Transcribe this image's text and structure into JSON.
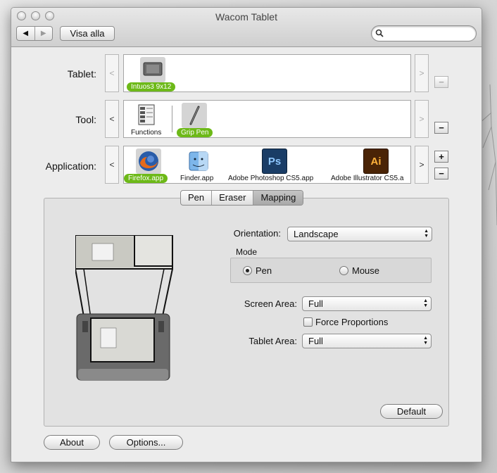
{
  "window": {
    "title": "Wacom Tablet"
  },
  "toolbar": {
    "show_all_label": "Visa alla",
    "search_value": ""
  },
  "rows": {
    "tablet": {
      "label": "Tablet:",
      "items": [
        {
          "name": "Intuos3 9x12",
          "selected": true
        }
      ]
    },
    "tool": {
      "label": "Tool:",
      "items": [
        {
          "name": "Functions"
        },
        {
          "name": "Grip Pen",
          "selected": true
        }
      ]
    },
    "application": {
      "label": "Application:",
      "items": [
        {
          "name": "Firefox.app",
          "selected": true
        },
        {
          "name": "Finder.app"
        },
        {
          "name": "Adobe Photoshop CS5.app",
          "icon_text": "Ps"
        },
        {
          "name": "Adobe Illustrator CS5.a",
          "icon_text": "Ai"
        }
      ]
    }
  },
  "tabs": {
    "pen": "Pen",
    "eraser": "Eraser",
    "mapping": "Mapping",
    "active": "Mapping"
  },
  "mapping": {
    "orientation_label": "Orientation:",
    "orientation_value": "Landscape",
    "mode_label": "Mode",
    "mode_pen": "Pen",
    "mode_mouse": "Mouse",
    "mode_selected": "Pen",
    "screen_area_label": "Screen Area:",
    "screen_area_value": "Full",
    "force_proportions_label": "Force Proportions",
    "force_proportions_checked": false,
    "tablet_area_label": "Tablet Area:",
    "tablet_area_value": "Full",
    "default_button": "Default"
  },
  "footer": {
    "about_button": "About",
    "options_button": "Options..."
  },
  "glyphs": {
    "prev": "<",
    "next": ">",
    "minus": "−",
    "plus": "+",
    "back": "◀",
    "forward": "▶",
    "updown_up": "▲",
    "updown_down": "▼"
  },
  "colors": {
    "selection_pill": "#6db918",
    "photoshop_blue": "#2a6fbf",
    "illustrator_orange": "#e78a12"
  }
}
